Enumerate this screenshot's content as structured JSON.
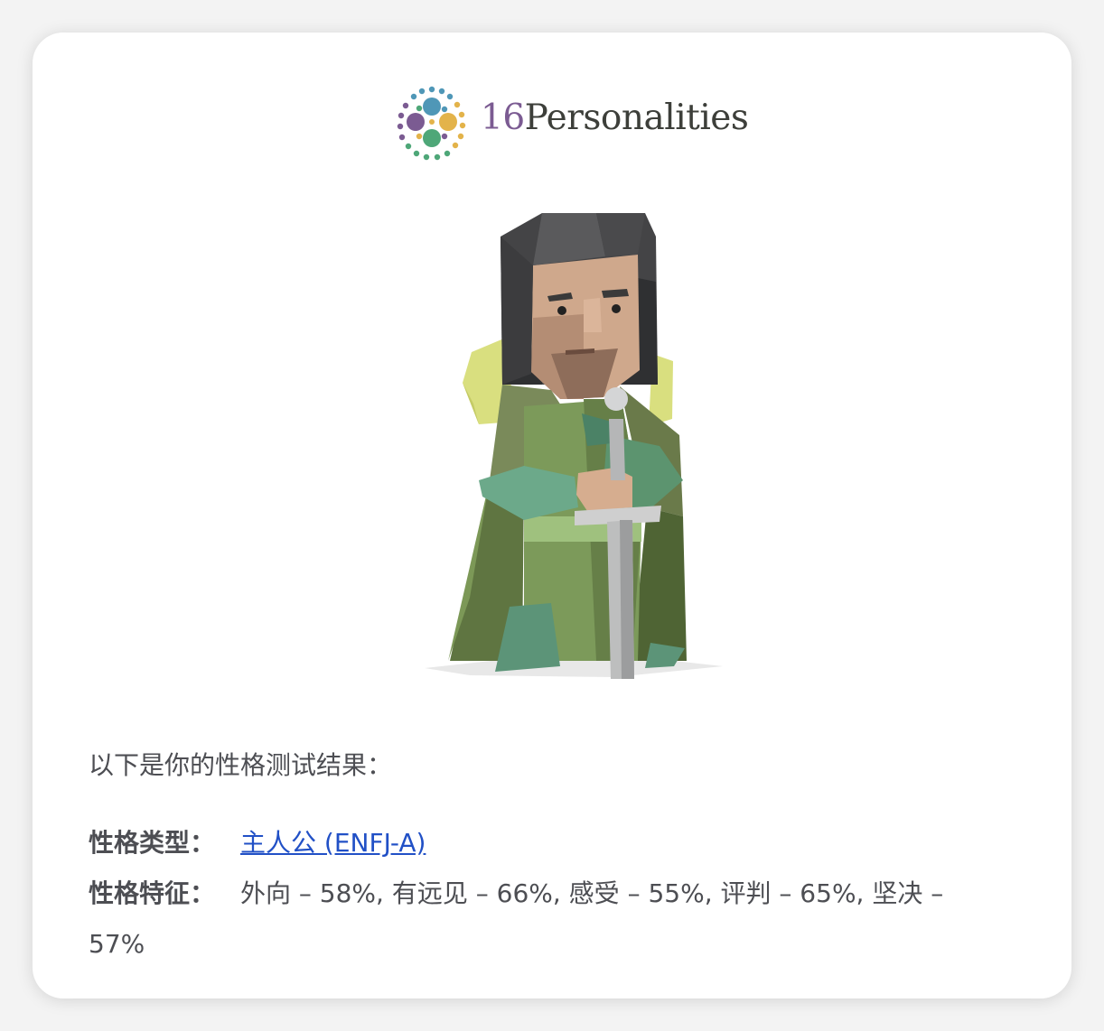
{
  "brand": {
    "number": "16",
    "name": "Personalities",
    "colors": {
      "purple": "#7b5b92",
      "blue": "#4f97b7",
      "gold": "#e3b34a",
      "green": "#4ea778"
    }
  },
  "result": {
    "intro": "以下是你的性格测试结果：",
    "type_label": "性格类型：",
    "type_value": "主人公 (ENFJ-A)",
    "traits_label": "性格特征：",
    "traits_line1": "外向 – 58%, 有远见 – 66%, 感受 – 55%, 评判 – 65%, 坚决 –",
    "traits_line2": "57%"
  },
  "illustration": {
    "name": "protagonist-knight-icon"
  }
}
